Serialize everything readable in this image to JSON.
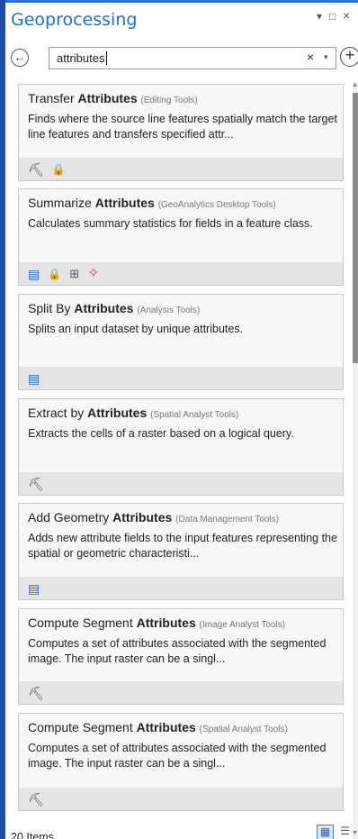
{
  "panel": {
    "title": "Geoprocessing",
    "controls": {
      "options": "▾",
      "maximize": "□",
      "close": "×"
    }
  },
  "search": {
    "back_icon": "←",
    "value": "attributes",
    "clear_icon": "×",
    "dropdown_icon": "▾",
    "add_icon": "+"
  },
  "results": [
    {
      "prefix": "Transfer ",
      "keyword": "Attributes",
      "suffix": "",
      "toolbox": "(Editing Tools)",
      "description": "Finds where the source line features spatially match the target line features and transfers specified attr...",
      "icons": [
        "hammer-icon",
        "lock-icon"
      ]
    },
    {
      "prefix": "Summarize ",
      "keyword": "Attributes",
      "suffix": "",
      "toolbox": "(GeoAnalytics Desktop Tools)",
      "description": "Calculates summary statistics for fields in a feature class.",
      "icons": [
        "script-icon",
        "lock-icon",
        "tree-icon",
        "spark-icon"
      ]
    },
    {
      "prefix": "Split By ",
      "keyword": "Attributes",
      "suffix": "",
      "toolbox": "(Analysis Tools)",
      "description": "Splits an input dataset by unique attributes.",
      "icons": [
        "script-icon"
      ]
    },
    {
      "prefix": "Extract by ",
      "keyword": "Attributes",
      "suffix": "",
      "toolbox": "(Spatial Analyst Tools)",
      "description": "Extracts the cells of a raster based on a logical query.",
      "icons": [
        "hammer-icon"
      ]
    },
    {
      "prefix": "Add Geometry ",
      "keyword": "Attributes",
      "suffix": "",
      "toolbox": "(Data Management Tools)",
      "description": "Adds new attribute fields to the input features representing the spatial or geometric characteristi...",
      "icons": [
        "script-icon"
      ]
    },
    {
      "prefix": "Compute Segment ",
      "keyword": "Attributes",
      "suffix": "",
      "toolbox": "(Image Analyst Tools)",
      "description": "Computes a set of attributes associated with the segmented image. The input raster can be a singl...",
      "icons": [
        "hammer-icon"
      ]
    },
    {
      "prefix": "Compute Segment ",
      "keyword": "Attributes",
      "suffix": "",
      "toolbox": "(Spatial Analyst Tools)",
      "description": "Computes a set of attributes associated with the segmented image. The input raster can be a singl...",
      "icons": [
        "hammer-icon"
      ]
    }
  ],
  "status": {
    "count": "20 Items"
  },
  "colors": {
    "accent": "#1a73c9",
    "frame": "#1f4e9e",
    "footer": "#e4e4e4"
  }
}
